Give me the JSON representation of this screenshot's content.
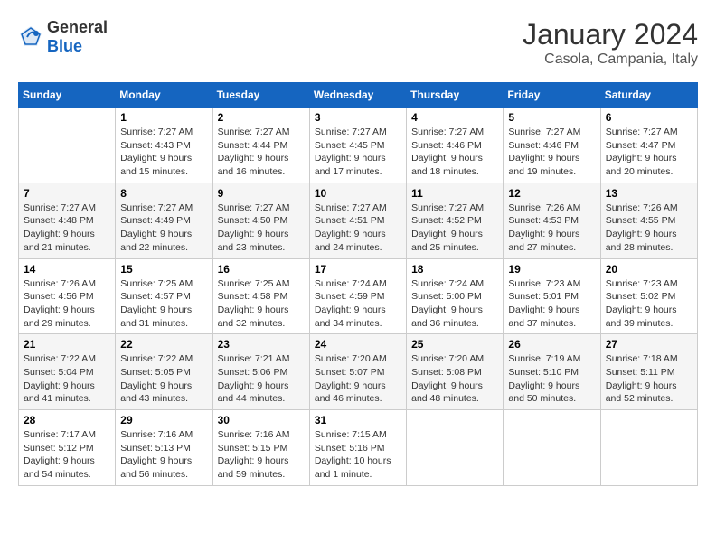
{
  "logo": {
    "text_general": "General",
    "text_blue": "Blue"
  },
  "header": {
    "month": "January 2024",
    "location": "Casola, Campania, Italy"
  },
  "days_of_week": [
    "Sunday",
    "Monday",
    "Tuesday",
    "Wednesday",
    "Thursday",
    "Friday",
    "Saturday"
  ],
  "weeks": [
    [
      {
        "day": "",
        "info": ""
      },
      {
        "day": "1",
        "info": "Sunrise: 7:27 AM\nSunset: 4:43 PM\nDaylight: 9 hours\nand 15 minutes."
      },
      {
        "day": "2",
        "info": "Sunrise: 7:27 AM\nSunset: 4:44 PM\nDaylight: 9 hours\nand 16 minutes."
      },
      {
        "day": "3",
        "info": "Sunrise: 7:27 AM\nSunset: 4:45 PM\nDaylight: 9 hours\nand 17 minutes."
      },
      {
        "day": "4",
        "info": "Sunrise: 7:27 AM\nSunset: 4:46 PM\nDaylight: 9 hours\nand 18 minutes."
      },
      {
        "day": "5",
        "info": "Sunrise: 7:27 AM\nSunset: 4:46 PM\nDaylight: 9 hours\nand 19 minutes."
      },
      {
        "day": "6",
        "info": "Sunrise: 7:27 AM\nSunset: 4:47 PM\nDaylight: 9 hours\nand 20 minutes."
      }
    ],
    [
      {
        "day": "7",
        "info": "Sunrise: 7:27 AM\nSunset: 4:48 PM\nDaylight: 9 hours\nand 21 minutes."
      },
      {
        "day": "8",
        "info": "Sunrise: 7:27 AM\nSunset: 4:49 PM\nDaylight: 9 hours\nand 22 minutes."
      },
      {
        "day": "9",
        "info": "Sunrise: 7:27 AM\nSunset: 4:50 PM\nDaylight: 9 hours\nand 23 minutes."
      },
      {
        "day": "10",
        "info": "Sunrise: 7:27 AM\nSunset: 4:51 PM\nDaylight: 9 hours\nand 24 minutes."
      },
      {
        "day": "11",
        "info": "Sunrise: 7:27 AM\nSunset: 4:52 PM\nDaylight: 9 hours\nand 25 minutes."
      },
      {
        "day": "12",
        "info": "Sunrise: 7:26 AM\nSunset: 4:53 PM\nDaylight: 9 hours\nand 27 minutes."
      },
      {
        "day": "13",
        "info": "Sunrise: 7:26 AM\nSunset: 4:55 PM\nDaylight: 9 hours\nand 28 minutes."
      }
    ],
    [
      {
        "day": "14",
        "info": "Sunrise: 7:26 AM\nSunset: 4:56 PM\nDaylight: 9 hours\nand 29 minutes."
      },
      {
        "day": "15",
        "info": "Sunrise: 7:25 AM\nSunset: 4:57 PM\nDaylight: 9 hours\nand 31 minutes."
      },
      {
        "day": "16",
        "info": "Sunrise: 7:25 AM\nSunset: 4:58 PM\nDaylight: 9 hours\nand 32 minutes."
      },
      {
        "day": "17",
        "info": "Sunrise: 7:24 AM\nSunset: 4:59 PM\nDaylight: 9 hours\nand 34 minutes."
      },
      {
        "day": "18",
        "info": "Sunrise: 7:24 AM\nSunset: 5:00 PM\nDaylight: 9 hours\nand 36 minutes."
      },
      {
        "day": "19",
        "info": "Sunrise: 7:23 AM\nSunset: 5:01 PM\nDaylight: 9 hours\nand 37 minutes."
      },
      {
        "day": "20",
        "info": "Sunrise: 7:23 AM\nSunset: 5:02 PM\nDaylight: 9 hours\nand 39 minutes."
      }
    ],
    [
      {
        "day": "21",
        "info": "Sunrise: 7:22 AM\nSunset: 5:04 PM\nDaylight: 9 hours\nand 41 minutes."
      },
      {
        "day": "22",
        "info": "Sunrise: 7:22 AM\nSunset: 5:05 PM\nDaylight: 9 hours\nand 43 minutes."
      },
      {
        "day": "23",
        "info": "Sunrise: 7:21 AM\nSunset: 5:06 PM\nDaylight: 9 hours\nand 44 minutes."
      },
      {
        "day": "24",
        "info": "Sunrise: 7:20 AM\nSunset: 5:07 PM\nDaylight: 9 hours\nand 46 minutes."
      },
      {
        "day": "25",
        "info": "Sunrise: 7:20 AM\nSunset: 5:08 PM\nDaylight: 9 hours\nand 48 minutes."
      },
      {
        "day": "26",
        "info": "Sunrise: 7:19 AM\nSunset: 5:10 PM\nDaylight: 9 hours\nand 50 minutes."
      },
      {
        "day": "27",
        "info": "Sunrise: 7:18 AM\nSunset: 5:11 PM\nDaylight: 9 hours\nand 52 minutes."
      }
    ],
    [
      {
        "day": "28",
        "info": "Sunrise: 7:17 AM\nSunset: 5:12 PM\nDaylight: 9 hours\nand 54 minutes."
      },
      {
        "day": "29",
        "info": "Sunrise: 7:16 AM\nSunset: 5:13 PM\nDaylight: 9 hours\nand 56 minutes."
      },
      {
        "day": "30",
        "info": "Sunrise: 7:16 AM\nSunset: 5:15 PM\nDaylight: 9 hours\nand 59 minutes."
      },
      {
        "day": "31",
        "info": "Sunrise: 7:15 AM\nSunset: 5:16 PM\nDaylight: 10 hours\nand 1 minute."
      },
      {
        "day": "",
        "info": ""
      },
      {
        "day": "",
        "info": ""
      },
      {
        "day": "",
        "info": ""
      }
    ]
  ]
}
